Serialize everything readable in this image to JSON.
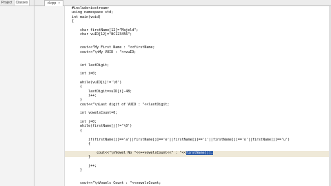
{
  "left_panel": {
    "tabs": [
      "Project",
      "Classes"
    ]
  },
  "editor": {
    "filename": "d.cpp",
    "close_glyph": "×"
  },
  "code": {
    "lines": [
      {
        "n": "1",
        "text": "#include<iostream>"
      },
      {
        "n": "2",
        "text": "using namespace std;"
      },
      {
        "n": "3",
        "text": "int main(void)"
      },
      {
        "n": "4",
        "text": "{"
      },
      {
        "n": "5",
        "text": ""
      },
      {
        "n": "6",
        "text": "    char firstName[12]=\"Majeld\";"
      },
      {
        "n": "7",
        "text": "    char vuID[12]=\"BC123456\";"
      },
      {
        "n": "8",
        "text": ""
      },
      {
        "n": "9",
        "text": ""
      },
      {
        "n": "10",
        "text": "    cout<<\"My First Name : \"<<firstName;"
      },
      {
        "n": "11",
        "text": "    cout<<\"\\nMy VUID : \"<<vuID;"
      },
      {
        "n": "12",
        "text": ""
      },
      {
        "n": "13",
        "text": ""
      },
      {
        "n": "14",
        "text": "    int lastDigit;"
      },
      {
        "n": "15",
        "text": ""
      },
      {
        "n": "16",
        "text": "    int i=0;"
      },
      {
        "n": "17",
        "text": ""
      },
      {
        "n": "18",
        "text": "    while(vuID[i]!='\\0')"
      },
      {
        "n": "19",
        "text": "    {"
      },
      {
        "n": "20",
        "text": "        lastDigit=vuID[i]-48;"
      },
      {
        "n": "21",
        "text": "        i++;"
      },
      {
        "n": "22",
        "text": "    }"
      },
      {
        "n": "23",
        "text": "    cout<<\"\\nLast digit of VUID : \"<<lastDigit;"
      },
      {
        "n": "24",
        "text": ""
      },
      {
        "n": "25",
        "text": "    int vowelsCount=0;"
      },
      {
        "n": "26",
        "text": ""
      },
      {
        "n": "27",
        "text": "    int j=0;"
      },
      {
        "n": "28",
        "text": "    while(firstName[j]!='\\0')"
      },
      {
        "n": "29",
        "text": "    {"
      },
      {
        "n": "30",
        "text": ""
      },
      {
        "n": "31",
        "text": "        if(firstName[j]=='a'||firstName[j]=='e'||firstName[j]=='i'||firstName[j]=='o'||firstName[j]=='u')"
      },
      {
        "n": "32",
        "text": "        {"
      },
      {
        "n": "33",
        "text": ""
      },
      {
        "n": "34",
        "text": "            cout<<\"\\nVowel No \"<<++vowelsCount<<\" : \"<<"
      },
      {
        "n": "35",
        "text": "        }"
      },
      {
        "n": "36",
        "text": ""
      },
      {
        "n": "37",
        "text": "        j++;"
      },
      {
        "n": "38",
        "text": "    }"
      },
      {
        "n": "39",
        "text": ""
      },
      {
        "n": "40",
        "text": ""
      },
      {
        "n": "41",
        "text": "    cout<<\"\\nVowels Count : \"<<vowelsCount;"
      }
    ],
    "selected_text": "firstName[j];",
    "current_line": "34"
  }
}
